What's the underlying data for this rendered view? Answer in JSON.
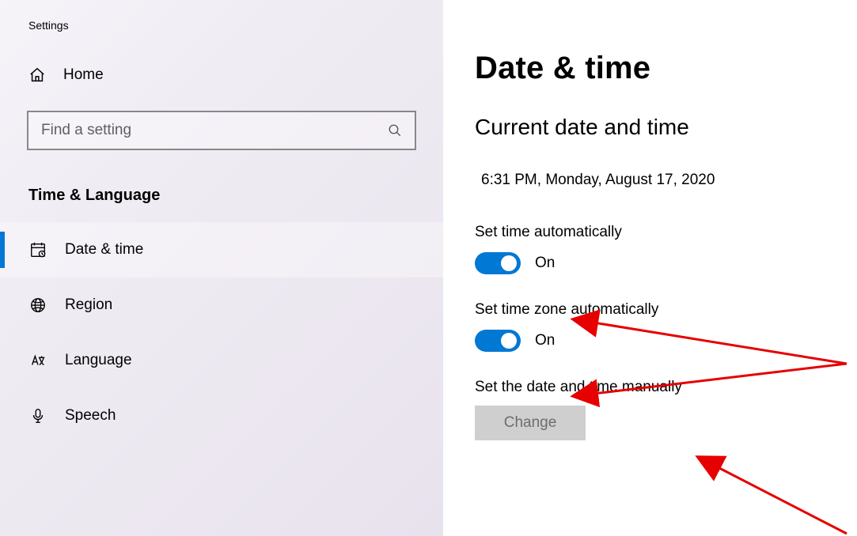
{
  "app_title": "Settings",
  "home_label": "Home",
  "search_placeholder": "Find a setting",
  "category_title": "Time & Language",
  "nav": [
    {
      "label": "Date & time",
      "active": true
    },
    {
      "label": "Region",
      "active": false
    },
    {
      "label": "Language",
      "active": false
    },
    {
      "label": "Speech",
      "active": false
    }
  ],
  "main": {
    "page_title": "Date & time",
    "section_title": "Current date and time",
    "current_datetime": "6:31 PM, Monday, August 17, 2020",
    "auto_time_label": "Set time automatically",
    "auto_time_state": "On",
    "auto_tz_label": "Set time zone automatically",
    "auto_tz_state": "On",
    "manual_label": "Set the date and time manually",
    "change_label": "Change"
  }
}
